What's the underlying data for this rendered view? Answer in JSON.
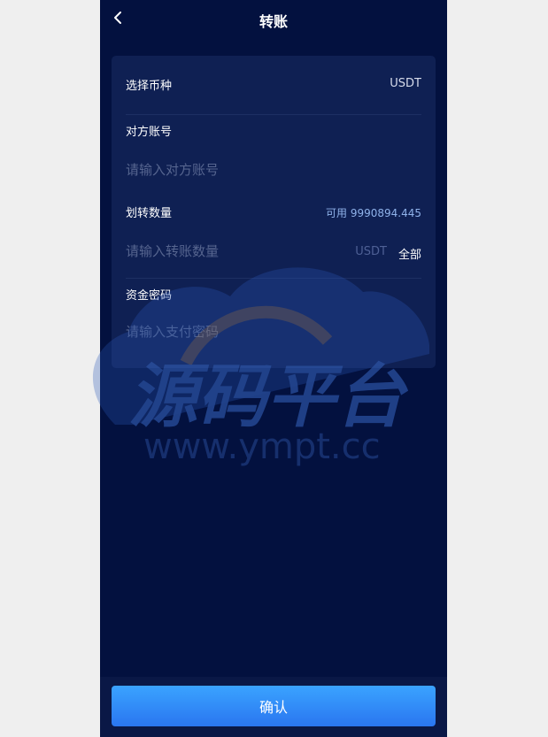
{
  "header": {
    "title": "转账"
  },
  "form": {
    "currency": {
      "label": "选择币种",
      "value": "USDT"
    },
    "account": {
      "label": "对方账号",
      "placeholder": "请输入对方账号"
    },
    "amount": {
      "label": "划转数量",
      "available": "可用 9990894.445",
      "placeholder": "请输入转账数量",
      "unit": "USDT",
      "all_label": "全部"
    },
    "password": {
      "label": "资金密码",
      "placeholder": "请输入支付密码"
    }
  },
  "footer": {
    "confirm_label": "确认"
  },
  "watermark": {
    "line1": "源码平台",
    "line2": "www.ympt.cc"
  },
  "colors": {
    "background": "#03113f",
    "card": "#0f2053",
    "button": "#3a9bff"
  }
}
